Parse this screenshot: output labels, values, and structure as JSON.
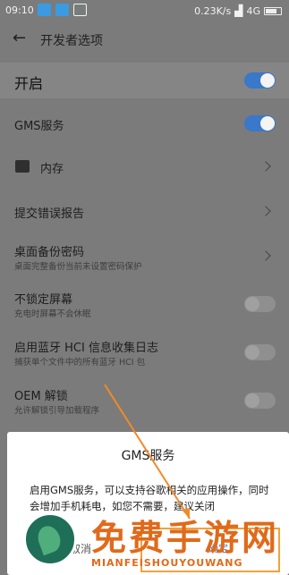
{
  "status_bar": {
    "time": "09:10",
    "network_speed": "0.23K/s",
    "signal": "4G",
    "signal_prefix": "4G"
  },
  "header": {
    "title": "开发者选项"
  },
  "rows": [
    {
      "label": "开启",
      "toggle": "on"
    },
    {
      "label": "GMS服务",
      "toggle": "on"
    },
    {
      "label": "内存"
    },
    {
      "label": "提交错误报告"
    },
    {
      "label": "桌面备份密码",
      "sub": "桌面完整备份当前未设置密码保护"
    },
    {
      "label": "不锁定屏幕",
      "sub": "充电时屏幕不会休眠",
      "toggle": "off"
    },
    {
      "label": "启用蓝牙 HCI 信息收集日志",
      "sub": "捕获单个文件中的所有蓝牙 HCI 包",
      "toggle": "off"
    },
    {
      "label": "OEM 解锁",
      "sub": "允许解锁引导加载程序",
      "toggle": "off"
    }
  ],
  "dialog": {
    "title": "GMS服务",
    "body": "启用GMS服务，可以支持谷歌相关的应用操作，同时会增加手机耗电，如您不需要，建议关闭",
    "cancel": "取消",
    "ok": "确定"
  },
  "watermark": {
    "title": "免费手游网",
    "subtitle": "MIANFEISHOUYOUWANG"
  },
  "colors": {
    "accent": "#3a78c9",
    "watermark": "#e06a1b",
    "highlight_box": "#f0a33a"
  }
}
